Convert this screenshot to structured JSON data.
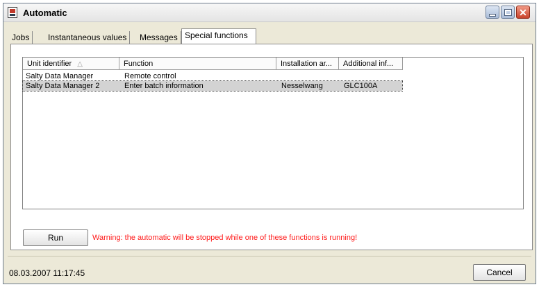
{
  "window": {
    "title": "Automatic"
  },
  "tabs": [
    {
      "label": "Jobs"
    },
    {
      "label": "Instantaneous values"
    },
    {
      "label": "Messages"
    },
    {
      "label": "Special functions"
    }
  ],
  "list": {
    "columns": [
      {
        "label": "Unit identifier"
      },
      {
        "label": "Function"
      },
      {
        "label": "Installation ar..."
      },
      {
        "label": "Additional inf..."
      }
    ],
    "rows": [
      {
        "unit": "Salty Data Manager",
        "function": "Remote control",
        "installation": "",
        "additional": ""
      },
      {
        "unit": "Salty Data Manager 2",
        "function": "Enter batch information",
        "installation": "Nesselwang",
        "additional": "GLC100A"
      }
    ]
  },
  "actions": {
    "run_label": "Run",
    "warning": "Warning: the automatic will be stopped while one of these functions is running!",
    "cancel_label": "Cancel"
  },
  "status": {
    "datetime": "08.03.2007 11:17:45"
  },
  "colors": {
    "warning": "#ff1a1a",
    "selected_row": "#d3d3d3"
  }
}
